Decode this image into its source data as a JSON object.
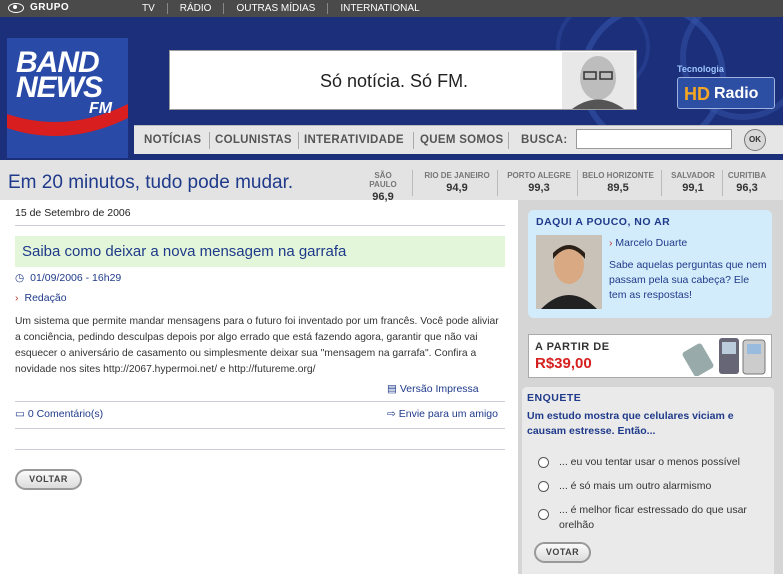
{
  "topbar": {
    "brand": "GRUPO",
    "nav": [
      "TV",
      "RÁDIO",
      "OUTRAS MÍDIAS",
      "INTERNATIONAL"
    ]
  },
  "logo": {
    "line1": "BAND",
    "line2": "NEWS",
    "suffix": "FM"
  },
  "banner": {
    "text": "Só notícia. Só FM."
  },
  "hd_radio": {
    "label": "Tecnologia",
    "hd": "HD",
    "radio": "Radio"
  },
  "menu": {
    "items": [
      "NOTÍCIAS",
      "COLUNISTAS",
      "INTERATIVIDADE",
      "QUEM SOMOS"
    ],
    "search_label": "BUSCA:",
    "search_value": "",
    "ok_label": "OK"
  },
  "tagline": "Em 20 minutos, tudo pode mudar.",
  "cities": [
    {
      "name": "SÃO PAULO",
      "freq": "96,9"
    },
    {
      "name": "RIO DE JANEIRO",
      "freq": "94,9"
    },
    {
      "name": "PORTO ALEGRE",
      "freq": "99,3"
    },
    {
      "name": "BELO HORIZONTE",
      "freq": "89,5"
    },
    {
      "name": "SALVADOR",
      "freq": "99,1"
    },
    {
      "name": "CURITIBA",
      "freq": "96,3"
    }
  ],
  "article": {
    "date": "15 de Setembro de 2006",
    "title": "Saiba como deixar a nova mensagem na garrafa",
    "timestamp": "01/09/2006 - 16h29",
    "author": "Redação",
    "body": "Um sistema que permite mandar mensagens para o futuro foi inventado por um francês. Você pode aliviar a conciência, pedindo desculpas depois por algo errado que está fazendo agora, garantir que não vai esquecer o aniversário de casamento ou simplesmente deixar sua \"mensagem na garrafa\". Confira a novidade nos sites http://2067.hypermoi.net/ e http://futureme.org/",
    "print_link": "Versão Impressa",
    "comments_link": "0 Comentário(s)",
    "send_link": "Envie para um amigo",
    "back_button": "VOLTAR"
  },
  "on_air": {
    "heading": "DAQUI A POUCO, NO AR",
    "host": "Marcelo Duarte",
    "description": "Sabe aquelas perguntas que nem passam pela sua cabeça? Ele tem as respostas!"
  },
  "ad": {
    "label": "A PARTIR DE",
    "price": "R$39,00"
  },
  "poll": {
    "heading": "ENQUETE",
    "question": "Um estudo mostra que celulares viciam e causam estresse. Então...",
    "options": [
      "... eu vou tentar usar o menos possível",
      "... é só mais um outro alarmismo",
      "... é melhor ficar estressado do que usar orelhão"
    ],
    "vote_button": "VOTAR"
  },
  "colors": {
    "header_bg": "#1b2f7a",
    "link_blue": "#1f3a8a",
    "title_bg": "#e4f6d9",
    "price_red": "#d62020"
  }
}
